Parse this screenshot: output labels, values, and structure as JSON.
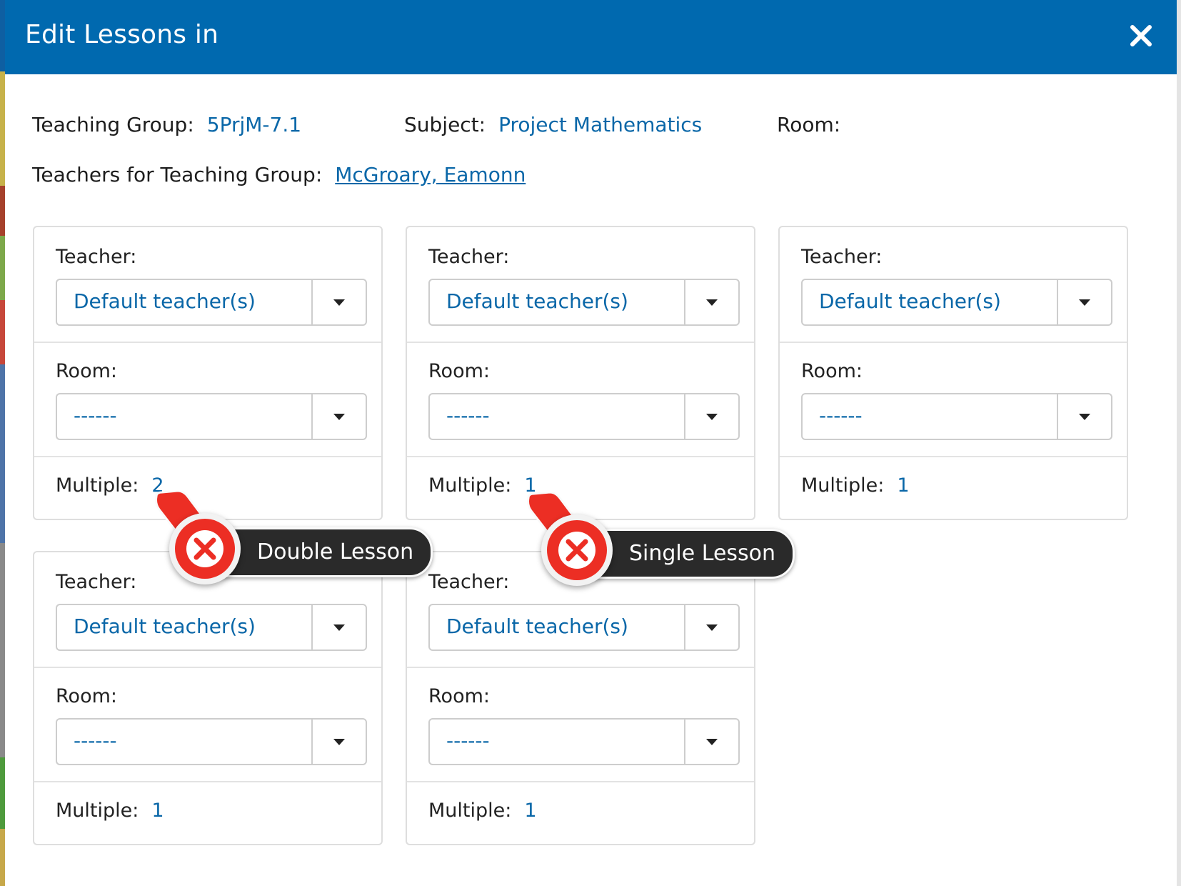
{
  "dialog": {
    "title": "Edit Lessons in",
    "close_icon": "close-icon"
  },
  "info": {
    "teaching_group_label": "Teaching Group:",
    "teaching_group_value": "5PrjM-7.1",
    "subject_label": "Subject:",
    "subject_value": "Project Mathematics",
    "room_label": "Room:",
    "teachers_label": "Teachers for Teaching Group:",
    "teachers_value": "McGroary, Eamonn"
  },
  "lessons": [
    {
      "teacher_label": "Teacher:",
      "teacher_value": "Default teacher(s)",
      "room_label": "Room:",
      "room_value": "------",
      "multiple_label": "Multiple:",
      "multiple_value": "2"
    },
    {
      "teacher_label": "Teacher:",
      "teacher_value": "Default teacher(s)",
      "room_label": "Room:",
      "room_value": "------",
      "multiple_label": "Multiple:",
      "multiple_value": "1"
    },
    {
      "teacher_label": "Teacher:",
      "teacher_value": "Default teacher(s)",
      "room_label": "Room:",
      "room_value": "------",
      "multiple_label": "Multiple:",
      "multiple_value": "1"
    },
    {
      "teacher_label": "Teacher:",
      "teacher_value": "Default teacher(s)",
      "room_label": "Room:",
      "room_value": "------",
      "multiple_label": "Multiple:",
      "multiple_value": "1"
    },
    {
      "teacher_label": "Teacher:",
      "teacher_value": "Default teacher(s)",
      "room_label": "Room:",
      "room_value": "------",
      "multiple_label": "Multiple:",
      "multiple_value": "1"
    }
  ],
  "annotations": [
    {
      "text": "Double Lesson",
      "icon": "x-circle-icon"
    },
    {
      "text": "Single Lesson",
      "icon": "x-circle-icon"
    }
  ],
  "colors": {
    "header": "#0069af",
    "link": "#0a67a8",
    "annotation_red": "#ec2e24",
    "annotation_bubble": "#2a2a2a"
  }
}
